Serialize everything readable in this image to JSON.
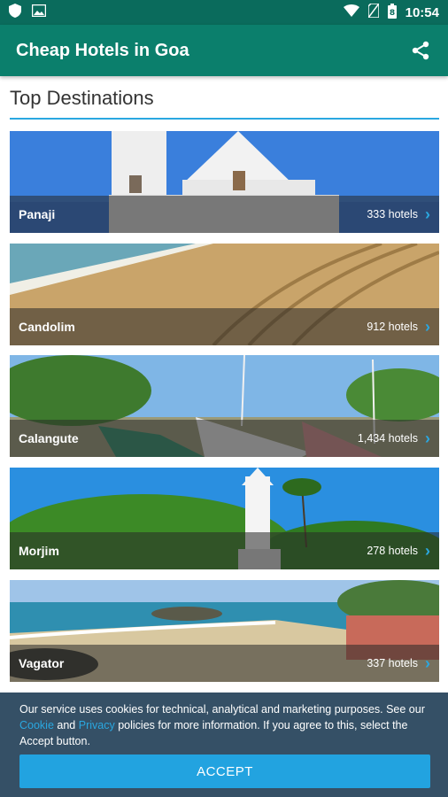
{
  "status_bar": {
    "time": "10:54"
  },
  "app_bar": {
    "title": "Cheap Hotels in Goa"
  },
  "section": {
    "title": "Top Destinations"
  },
  "destinations": [
    {
      "name": "Panaji",
      "hotels": "333 hotels"
    },
    {
      "name": "Candolim",
      "hotels": "912 hotels"
    },
    {
      "name": "Calangute",
      "hotels": "1,434 hotels"
    },
    {
      "name": "Morjim",
      "hotels": "278 hotels"
    },
    {
      "name": "Vagator",
      "hotels": "337 hotels"
    }
  ],
  "cookie": {
    "text_1": "Our service uses cookies for technical, analytical and marketing purposes. See our",
    "link_cookie": "Cookie",
    "text_2": "and",
    "link_privacy": "Privacy",
    "text_3": "policies for more information. If you agree to this, select the Accept button.",
    "accept_label": "ACCEPT"
  },
  "colors": {
    "primary": "#0b7f6c",
    "status": "#0a6b5c",
    "accent": "#22a3e0",
    "cookie_bg": "#355066"
  }
}
